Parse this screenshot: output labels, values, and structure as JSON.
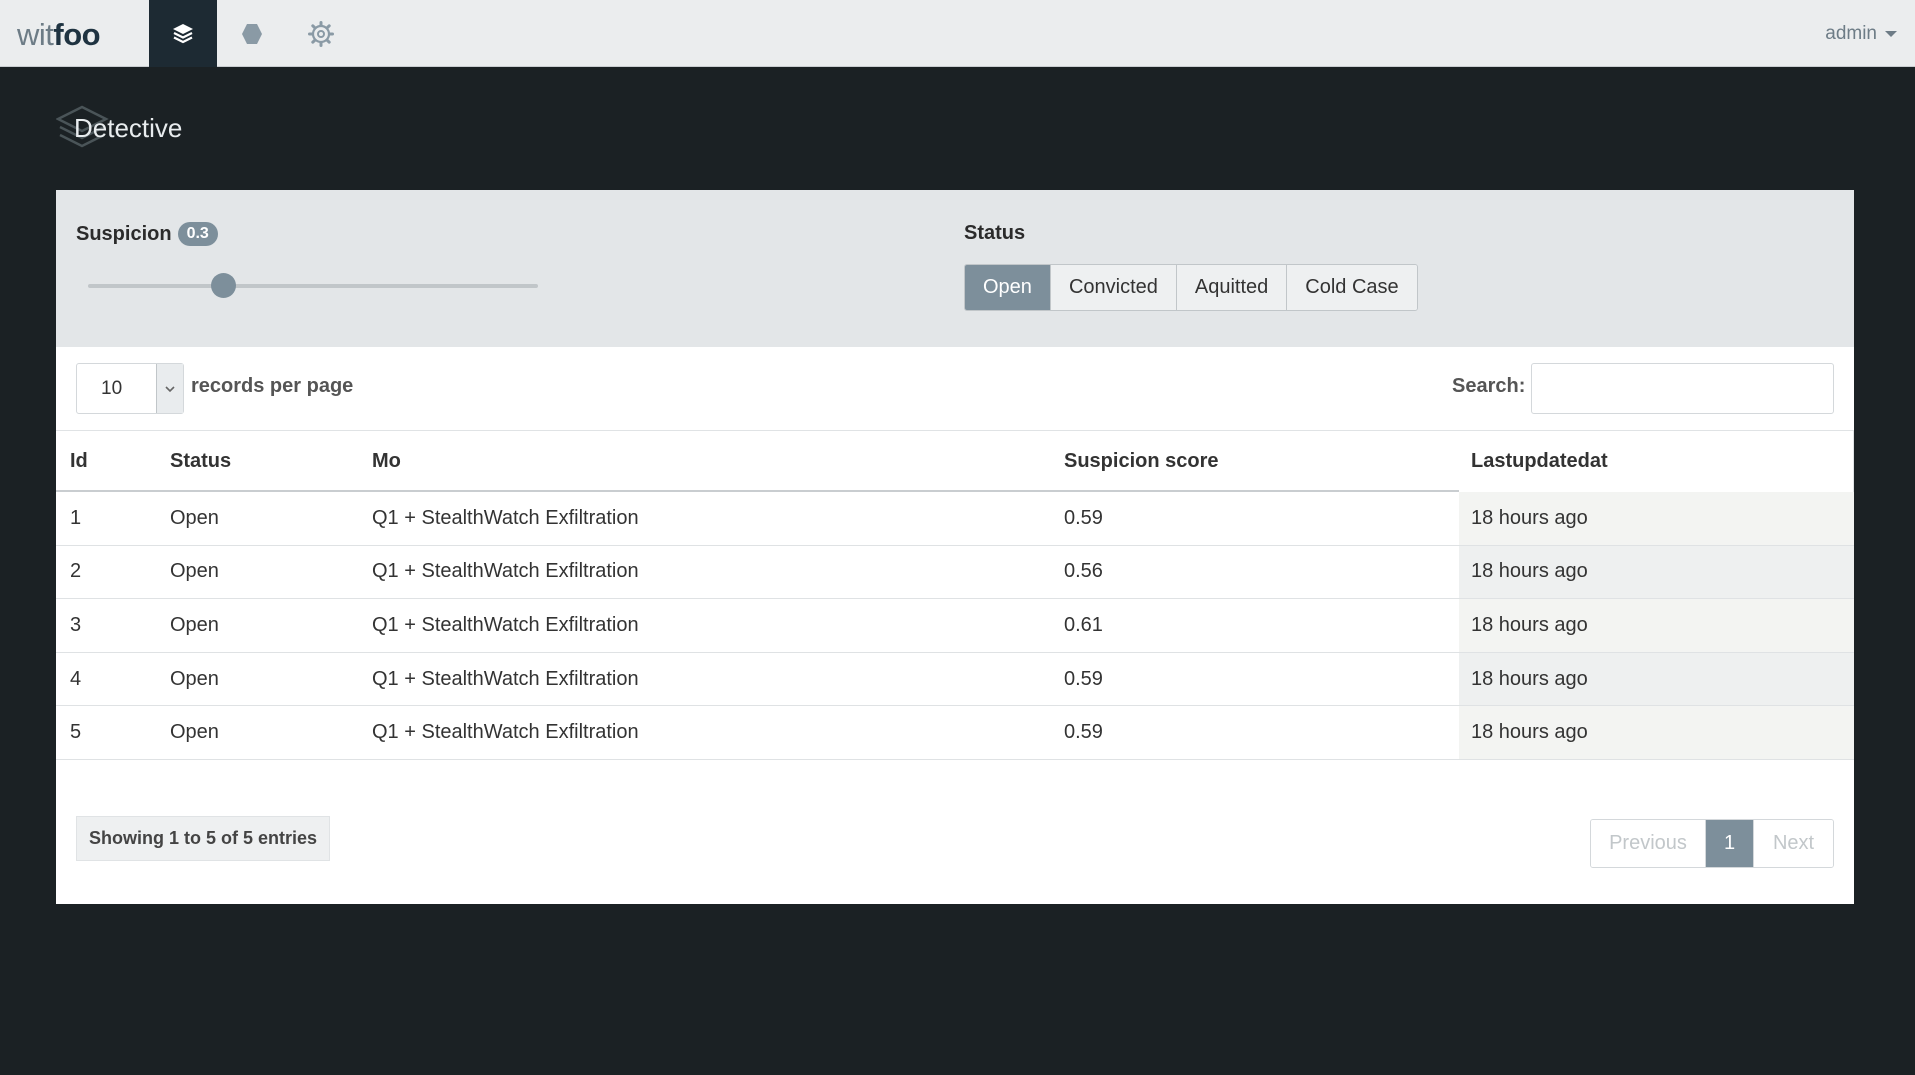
{
  "app": {
    "logo_light": "wit",
    "logo_bold": "foo",
    "user": "admin"
  },
  "nav": [
    {
      "icon": "layers-icon",
      "active": true
    },
    {
      "icon": "hexagon-icon",
      "active": false
    },
    {
      "icon": "gear-icon",
      "active": false
    }
  ],
  "page": {
    "title": "Detective"
  },
  "filters": {
    "suspicion_label": "Suspicion",
    "suspicion_value": "0.3",
    "suspicion_fraction": 0.3,
    "status_label": "Status",
    "status_options": [
      "Open",
      "Convicted",
      "Aquitted",
      "Cold Case"
    ],
    "status_selected": "Open"
  },
  "table_controls": {
    "page_length": "10",
    "page_length_label": "records per page",
    "search_label": "Search:",
    "search_value": ""
  },
  "table": {
    "columns": [
      "Id",
      "Status",
      "Mo",
      "Suspicion score",
      "Lastupdatedat"
    ],
    "sorted_column": "Lastupdatedat",
    "rows": [
      {
        "id": "1",
        "status": "Open",
        "mo": "Q1 + StealthWatch Exfiltration",
        "score": "0.59",
        "updated": "18 hours ago"
      },
      {
        "id": "2",
        "status": "Open",
        "mo": "Q1 + StealthWatch Exfiltration",
        "score": "0.56",
        "updated": "18 hours ago"
      },
      {
        "id": "3",
        "status": "Open",
        "mo": "Q1 + StealthWatch Exfiltration",
        "score": "0.61",
        "updated": "18 hours ago"
      },
      {
        "id": "4",
        "status": "Open",
        "mo": "Q1 + StealthWatch Exfiltration",
        "score": "0.59",
        "updated": "18 hours ago"
      },
      {
        "id": "5",
        "status": "Open",
        "mo": "Q1 + StealthWatch Exfiltration",
        "score": "0.59",
        "updated": "18 hours ago"
      }
    ]
  },
  "footer": {
    "info": "Showing 1 to 5 of 5 entries",
    "prev_label": "Previous",
    "current_page": "1",
    "next_label": "Next"
  },
  "colors": {
    "accent": "#7d8f9b",
    "background": "#1b2124",
    "topbar": "#ebedee"
  }
}
